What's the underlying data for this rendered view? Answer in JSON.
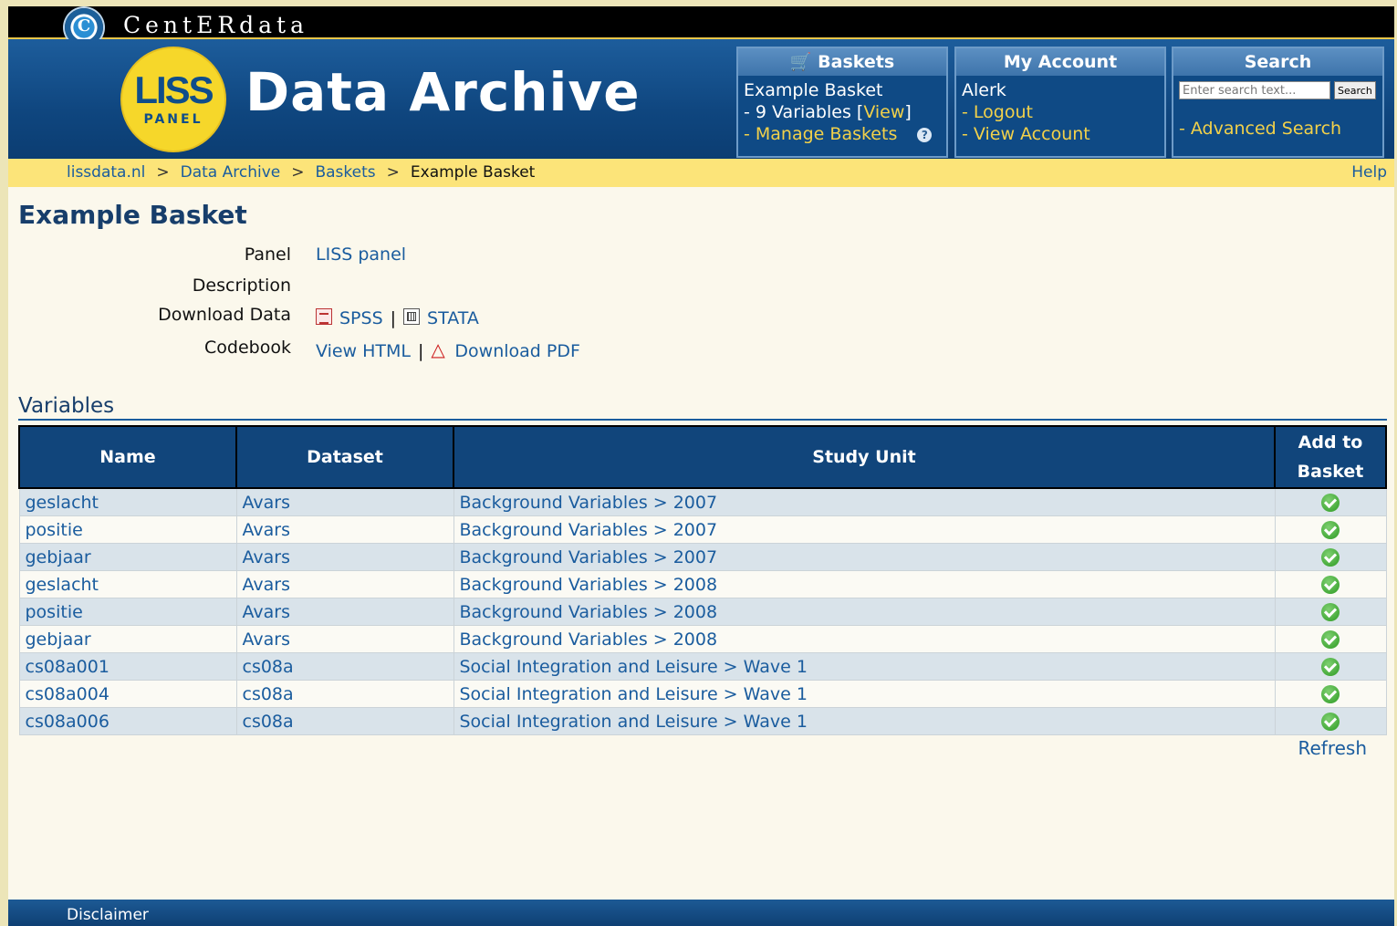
{
  "header": {
    "org_name": "CentERdata",
    "org_logo_letter": "C",
    "liss_logo_big": "LISS",
    "liss_logo_small": "PANEL",
    "site_title": "Data Archive"
  },
  "baskets_panel": {
    "title": "Baskets",
    "basket_name": "Example Basket",
    "variables_prefix": "- 9 Variables [",
    "view_link": "View",
    "variables_suffix": "]",
    "manage_link": "- Manage Baskets"
  },
  "account_panel": {
    "title": "My Account",
    "user": "Alerk",
    "logout": "- Logout",
    "view_account": "- View Account"
  },
  "search_panel": {
    "title": "Search",
    "input_value": "Enter search text...",
    "button": "Search",
    "advanced": "- Advanced Search"
  },
  "breadcrumb": {
    "items": [
      "lissdata.nl",
      "Data Archive",
      "Baskets"
    ],
    "current": "Example Basket",
    "separator": ">",
    "help": "Help"
  },
  "page": {
    "title": "Example Basket",
    "panel_label": "Panel",
    "panel_value": "LISS panel",
    "description_label": "Description",
    "download_label": "Download Data",
    "spss": "SPSS",
    "stata": "STATA",
    "codebook_label": "Codebook",
    "view_html": "View HTML",
    "download_pdf": "Download PDF",
    "pipe": "|"
  },
  "variables": {
    "heading": "Variables",
    "columns": [
      "Name",
      "Dataset",
      "Study Unit",
      "Add to Basket"
    ],
    "rows": [
      {
        "name": "geslacht",
        "dataset": "Avars",
        "study_unit": "Background Variables > 2007"
      },
      {
        "name": "positie",
        "dataset": "Avars",
        "study_unit": "Background Variables > 2007"
      },
      {
        "name": "gebjaar",
        "dataset": "Avars",
        "study_unit": "Background Variables > 2007"
      },
      {
        "name": "geslacht",
        "dataset": "Avars",
        "study_unit": "Background Variables > 2008"
      },
      {
        "name": "positie",
        "dataset": "Avars",
        "study_unit": "Background Variables > 2008"
      },
      {
        "name": "gebjaar",
        "dataset": "Avars",
        "study_unit": "Background Variables > 2008"
      },
      {
        "name": "cs08a001",
        "dataset": "cs08a",
        "study_unit": "Social Integration and Leisure > Wave 1"
      },
      {
        "name": "cs08a004",
        "dataset": "cs08a",
        "study_unit": "Social Integration and Leisure > Wave 1"
      },
      {
        "name": "cs08a006",
        "dataset": "cs08a",
        "study_unit": "Social Integration and Leisure > Wave 1"
      }
    ],
    "refresh": "Refresh"
  },
  "footer": {
    "disclaimer": "Disclaimer"
  }
}
